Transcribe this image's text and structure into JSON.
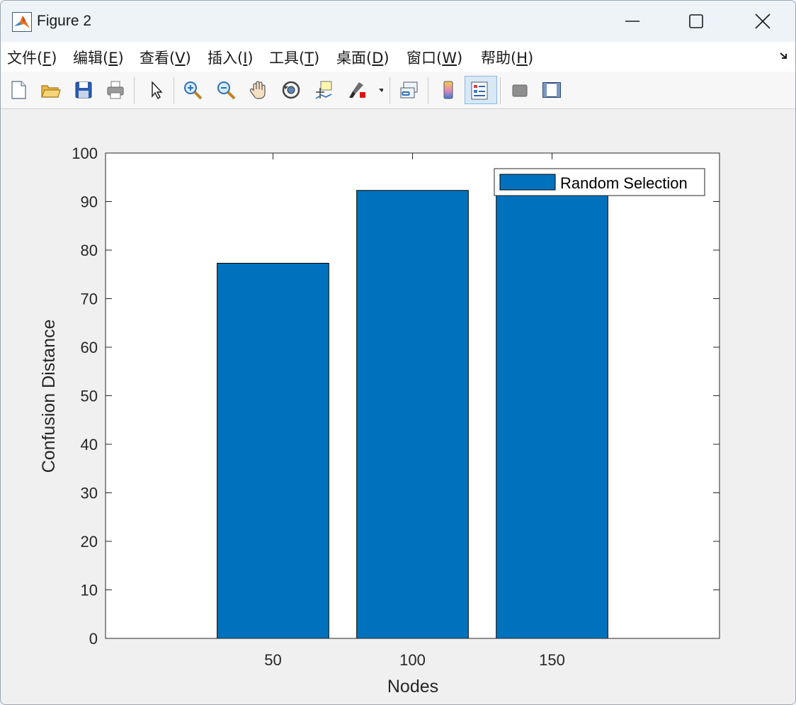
{
  "window": {
    "title": "Figure 2",
    "controls": {
      "minimize": "minimize",
      "maximize": "maximize",
      "close": "close"
    }
  },
  "menu": [
    {
      "label": "文件(",
      "key": "F",
      "tail": ")"
    },
    {
      "label": "编辑(",
      "key": "E",
      "tail": ")"
    },
    {
      "label": "查看(",
      "key": "V",
      "tail": ")"
    },
    {
      "label": "插入(",
      "key": "I",
      "tail": ")"
    },
    {
      "label": "工具(",
      "key": "T",
      "tail": ")"
    },
    {
      "label": "桌面(",
      "key": "D",
      "tail": ")"
    },
    {
      "label": "窗口(",
      "key": "W",
      "tail": ")"
    },
    {
      "label": "帮助(",
      "key": "H",
      "tail": ")"
    }
  ],
  "toolbar": {
    "icons": [
      "new-file-icon",
      "open-folder-icon",
      "save-icon",
      "print-icon",
      "pointer-icon",
      "zoom-in-icon",
      "zoom-out-icon",
      "pan-hand-icon",
      "rotate-3d-icon",
      "data-cursor-icon",
      "brush-icon",
      "link-plot-icon",
      "colorbar-icon",
      "legend-icon",
      "hide-plot-tools-icon",
      "show-plot-tools-icon"
    ],
    "active": "legend-icon"
  },
  "chart_data": {
    "type": "bar",
    "categories": [
      "50",
      "100",
      "150"
    ],
    "series": [
      {
        "name": "Random Selection",
        "values": [
          77.3,
          92.3,
          92.3
        ],
        "color": "#0072bd"
      }
    ],
    "xlabel": "Nodes",
    "ylabel": "Confusion Distance",
    "ylim": [
      0,
      100
    ],
    "yticks": [
      "0",
      "10",
      "20",
      "30",
      "40",
      "50",
      "60",
      "70",
      "80",
      "90",
      "100"
    ],
    "legend_position": "top-right",
    "grid": false
  }
}
